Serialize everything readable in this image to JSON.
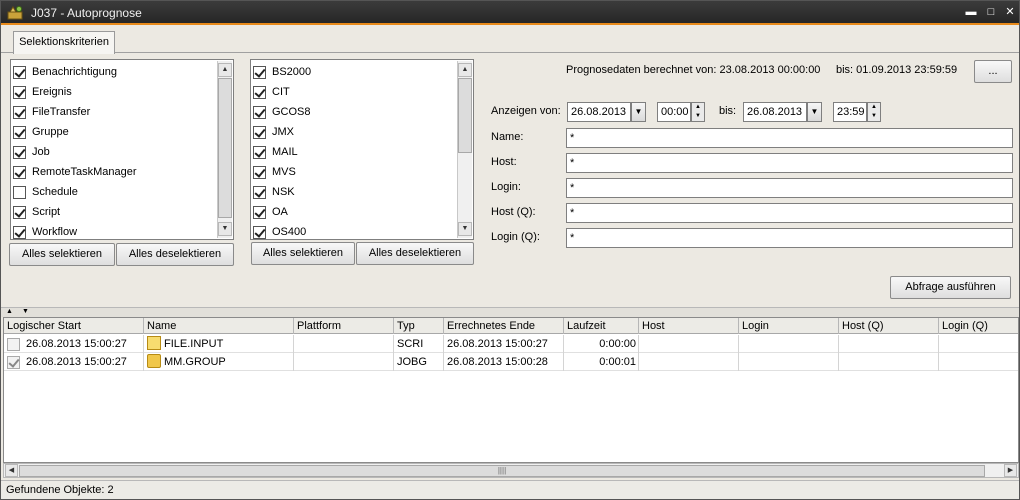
{
  "window": {
    "title": "J037 - Autoprognose",
    "minimize_icon": "minimize-icon",
    "maximize_icon": "maximize-icon",
    "close_icon": "close-icon"
  },
  "tabs": [
    {
      "label": "Selektionskriterien"
    }
  ],
  "event_list": {
    "items": [
      {
        "label": "Benachrichtigung",
        "checked": true
      },
      {
        "label": "Ereignis",
        "checked": true
      },
      {
        "label": "FileTransfer",
        "checked": true
      },
      {
        "label": "Gruppe",
        "checked": true
      },
      {
        "label": "Job",
        "checked": true
      },
      {
        "label": "RemoteTaskManager",
        "checked": true
      },
      {
        "label": "Schedule",
        "checked": false
      },
      {
        "label": "Script",
        "checked": true
      },
      {
        "label": "Workflow",
        "checked": true
      }
    ],
    "select_all_label": "Alles selektieren",
    "deselect_all_label": "Alles deselektieren"
  },
  "platform_list": {
    "items": [
      {
        "label": "BS2000",
        "checked": true
      },
      {
        "label": "CIT",
        "checked": true
      },
      {
        "label": "GCOS8",
        "checked": true
      },
      {
        "label": "JMX",
        "checked": true
      },
      {
        "label": "MAIL",
        "checked": true
      },
      {
        "label": "MVS",
        "checked": true
      },
      {
        "label": "NSK",
        "checked": true
      },
      {
        "label": "OA",
        "checked": true
      },
      {
        "label": "OS400",
        "checked": true
      }
    ],
    "select_all_label": "Alles selektieren",
    "deselect_all_label": "Alles deselektieren"
  },
  "forecast": {
    "range_text": "Prognosedaten berechnet von: 23.08.2013 00:00:00",
    "until_text": "bis: 01.09.2013 23:59:59",
    "more_button": "...",
    "show_from_label": "Anzeigen von:",
    "from_date": "26.08.2013",
    "from_time": "00:00",
    "until_label": "bis:",
    "to_date": "26.08.2013",
    "to_time": "23:59",
    "name_label": "Name:",
    "name_value": "*",
    "host_label": "Host:",
    "host_value": "*",
    "login_label": "Login:",
    "login_value": "*",
    "hostq_label": "Host (Q):",
    "hostq_value": "*",
    "loginq_label": "Login (Q):",
    "loginq_value": "*",
    "run_query_label": "Abfrage ausführen"
  },
  "table": {
    "columns": [
      "Logischer Start",
      "Name",
      "Plattform",
      "Typ",
      "Errechnetes Ende",
      "Laufzeit",
      "Host",
      "Login",
      "Host (Q)",
      "Login (Q)"
    ],
    "rows": [
      {
        "checked": false,
        "start": "26.08.2013 15:00:27",
        "name": "FILE.INPUT",
        "icon": "script-icon",
        "platform": "",
        "type": "SCRI",
        "end": "26.08.2013 15:00:27",
        "runtime": "0:00:00",
        "host": "",
        "login": "",
        "hostq": "",
        "loginq": ""
      },
      {
        "checked": true,
        "start": "26.08.2013 15:00:27",
        "name": "MM.GROUP",
        "icon": "group-icon",
        "platform": "",
        "type": "JOBG",
        "end": "26.08.2013 15:00:28",
        "runtime": "0:00:01",
        "host": "",
        "login": "",
        "hostq": "",
        "loginq": ""
      }
    ]
  },
  "status": {
    "text": "Gefundene Objekte: 2"
  },
  "colors": {
    "title_accent": "#e88a1a",
    "title_bg": "#2f2f2f",
    "window_bg": "#ece9e2"
  }
}
